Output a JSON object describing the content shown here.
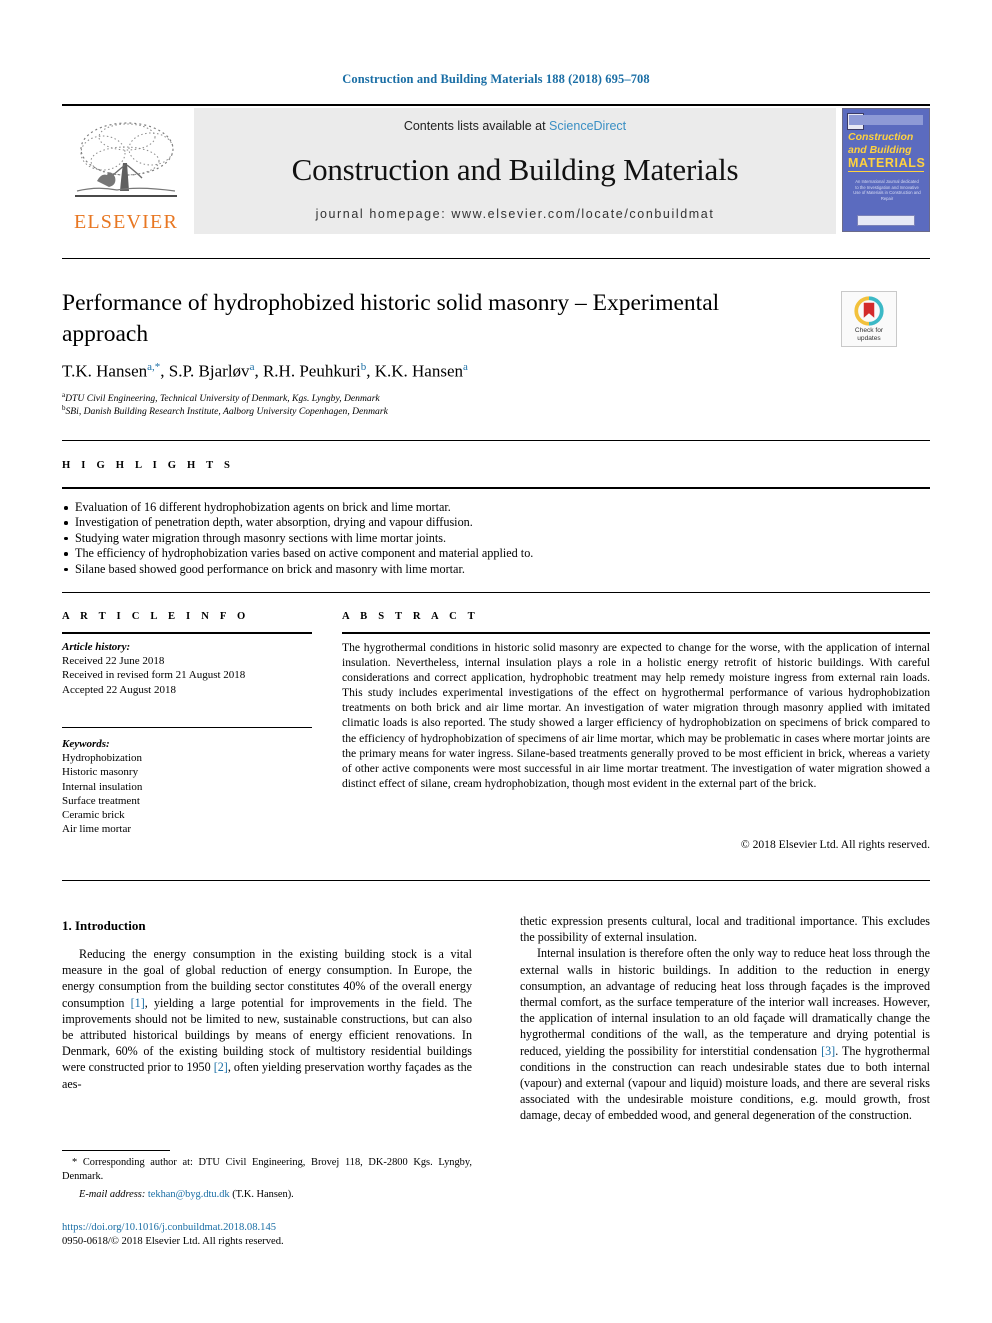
{
  "running_head": "Construction and Building Materials 188 (2018) 695–708",
  "masthead": {
    "contents_prefix": "Contents lists available at ",
    "sciencedirect": "ScienceDirect",
    "journal_name": "Construction and Building Materials",
    "homepage": "journal homepage: www.elsevier.com/locate/conbuildmat",
    "publisher": "ELSEVIER",
    "cover": {
      "line1": "Construction",
      "line2": "and Building",
      "line3": "MATERIALS",
      "blurb": "An International Journal dedicated to the Investigation and Innovative Use of Materials in Construction and Repair"
    },
    "accent_blue": "#3a8fc4",
    "elsevier_orange": "#e87722"
  },
  "article": {
    "title": "Performance of hydrophobized historic solid masonry – Experimental approach",
    "authors": [
      {
        "name": "T.K. Hansen",
        "sup": "a,*"
      },
      {
        "name": "S.P. Bjarløv",
        "sup": "a"
      },
      {
        "name": "R.H. Peuhkuri",
        "sup": "b"
      },
      {
        "name": "K.K. Hansen",
        "sup": "a"
      }
    ],
    "affiliations": [
      {
        "marker": "a",
        "text": "DTU Civil Engineering, Technical University of Denmark, Kgs. Lyngby, Denmark"
      },
      {
        "marker": "b",
        "text": "SBi, Danish Building Research Institute, Aalborg University Copenhagen, Denmark"
      }
    ],
    "crossmark": {
      "line1": "Check for",
      "line2": "updates"
    }
  },
  "highlights": {
    "heading": "H I G H L I G H T S",
    "items": [
      "Evaluation of 16 different hydrophobization agents on brick and lime mortar.",
      "Investigation of penetration depth, water absorption, drying and vapour diffusion.",
      "Studying water migration through masonry sections with lime mortar joints.",
      "The efficiency of hydrophobization varies based on active component and material applied to.",
      "Silane based showed good performance on brick and masonry with lime mortar."
    ]
  },
  "article_info": {
    "heading": "A R T I C L E   I N F O",
    "history_label": "Article history:",
    "history": [
      "Received 22 June 2018",
      "Received in revised form 21 August 2018",
      "Accepted 22 August 2018"
    ],
    "keywords_label": "Keywords:",
    "keywords": [
      "Hydrophobization",
      "Historic masonry",
      "Internal insulation",
      "Surface treatment",
      "Ceramic brick",
      "Air lime mortar"
    ]
  },
  "abstract": {
    "heading": "A B S T R A C T",
    "text": "The hygrothermal conditions in historic solid masonry are expected to change for the worse, with the application of internal insulation. Nevertheless, internal insulation plays a role in a holistic energy retrofit of historic buildings. With careful considerations and correct application, hydrophobic treatment may help remedy moisture ingress from external rain loads. This study includes experimental investigations of the effect on hygrothermal performance of various hydrophobization treatments on both brick and air lime mortar. An investigation of water migration through masonry applied with imitated climatic loads is also reported. The study showed a larger efficiency of hydrophobization on specimens of brick compared to the efficiency of hydrophobization of specimens of air lime mortar, which may be problematic in cases where mortar joints are the primary means for water ingress. Silane-based treatments generally proved to be most efficient in brick, whereas a variety of other active components were most successful in air lime mortar treatment. The investigation of water migration showed a distinct effect of silane, cream hydrophobization, though most evident in the external part of the brick.",
    "copyright": "© 2018 Elsevier Ltd. All rights reserved."
  },
  "body": {
    "section_title": "1. Introduction",
    "left_para_1_a": "Reducing the energy consumption in the existing building stock is a vital measure in the goal of global reduction of energy consumption. In Europe, the energy consumption from the building sector constitutes 40% of the overall energy consumption ",
    "left_ref_1": "[1]",
    "left_para_1_b": ", yielding a large potential for improvements in the field. The improvements should not be limited to new, sustainable constructions, but can also be attributed historical buildings by means of energy efficient renovations. In Denmark, 60% of the existing building stock of multistory residential buildings were constructed prior to 1950 ",
    "left_ref_2": "[2]",
    "left_para_1_c": ", often yielding preservation worthy façades as the aes-",
    "right_para_1": "thetic expression presents cultural, local and traditional importance. This excludes the possibility of external insulation.",
    "right_para_2_a": "Internal insulation is therefore often the only way to reduce heat loss through the external walls in historic buildings. In addition to the reduction in energy consumption, an advantage of reducing heat loss through façades is the improved thermal comfort, as the surface temperature of the interior wall increases. However, the application of internal insulation to an old façade will dramatically change the hygrothermal conditions of the wall, as the temperature and drying potential is reduced, yielding the possibility for interstitial condensation ",
    "right_ref_3": "[3]",
    "right_para_2_b": ". The hygrothermal conditions in the construction can reach undesirable states due to both internal (vapour) and external (vapour and liquid) moisture loads, and there are several risks associated with the undesirable moisture conditions, e.g. mould growth, frost damage, decay of embedded wood, and general degeneration of the construction."
  },
  "footer": {
    "corresponding_marker": "*",
    "corresponding_text": "Corresponding author at: DTU Civil Engineering, Brovej 118, DK-2800 Kgs. Lyngby, Denmark.",
    "email_label": "E-mail address:",
    "email": "tekhan@byg.dtu.dk",
    "email_owner": "(T.K. Hansen).",
    "doi": "https://doi.org/10.1016/j.conbuildmat.2018.08.145",
    "issn_line": "0950-0618/© 2018 Elsevier Ltd. All rights reserved."
  }
}
